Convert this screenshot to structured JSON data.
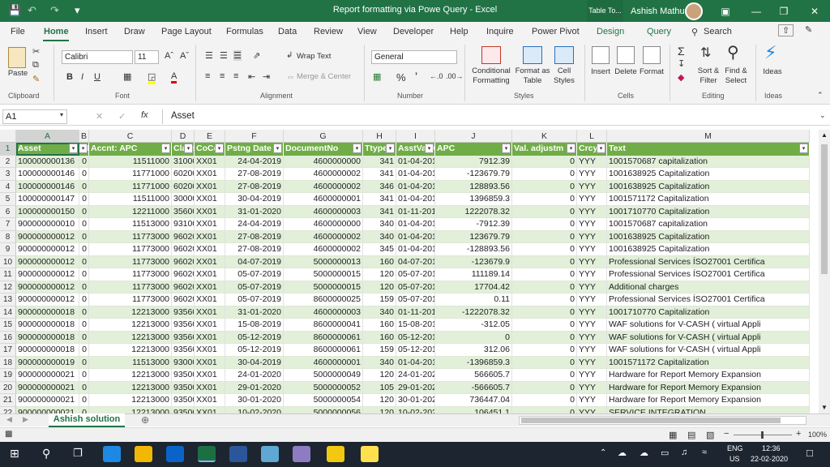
{
  "title_bar": {
    "title": "Report formatting via Powe Query  -  Excel",
    "table_tools": "Table To...",
    "user": "Ashish Mathur"
  },
  "menu": [
    "File",
    "Home",
    "Insert",
    "Draw",
    "Page Layout",
    "Formulas",
    "Data",
    "Review",
    "View",
    "Developer",
    "Help",
    "Inquire",
    "Power Pivot",
    "Design",
    "Query"
  ],
  "search_label": "Search",
  "ribbon": {
    "clipboard": {
      "paste": "Paste",
      "label": "Clipboard"
    },
    "font": {
      "name": "Calibri",
      "size": "11",
      "label": "Font"
    },
    "alignment": {
      "wrap": "Wrap Text",
      "merge": "Merge & Center",
      "label": "Alignment"
    },
    "number": {
      "format": "General",
      "label": "Number"
    },
    "styles": {
      "cond": "Conditional Formatting",
      "fmt_table": "Format as Table",
      "cell_styles": "Cell Styles",
      "label": "Styles"
    },
    "cells": {
      "insert": "Insert",
      "delete": "Delete",
      "format": "Format",
      "label": "Cells"
    },
    "editing": {
      "sort": "Sort & Filter",
      "find": "Find & Select",
      "label": "Editing"
    },
    "ideas": {
      "ideas": "Ideas",
      "label": "Ideas"
    }
  },
  "formula_bar": {
    "name_box": "A1",
    "content": "Asset"
  },
  "columns": [
    "A",
    "B",
    "C",
    "D",
    "E",
    "F",
    "G",
    "H",
    "I",
    "J",
    "K",
    "L",
    "M"
  ],
  "headers": [
    "Asset",
    "SNo.",
    "Accnt: APC",
    "Class",
    "CoCd",
    "Pstng Date",
    "DocumentNo",
    "Ttype",
    "AsstValDat",
    "APC",
    "Val. adjustm",
    "Crcy",
    "Text"
  ],
  "rows": [
    [
      "100000000136",
      "0",
      "11511000",
      "31000",
      "XX01",
      "24-04-2019",
      "4600000000",
      "341",
      "01-04-2019",
      "7912.39",
      "0",
      "YYY",
      "1001570687 capitalization"
    ],
    [
      "100000000146",
      "0",
      "11771000",
      "60200",
      "XX01",
      "27-08-2019",
      "4600000002",
      "341",
      "01-04-2019",
      "-123679.79",
      "0",
      "YYY",
      "1001638925 Capitalization"
    ],
    [
      "100000000146",
      "0",
      "11771000",
      "60200",
      "XX01",
      "27-08-2019",
      "4600000002",
      "346",
      "01-04-2019",
      "128893.56",
      "0",
      "YYY",
      "1001638925 Capitalization"
    ],
    [
      "100000000147",
      "0",
      "11511000",
      "30000",
      "XX01",
      "30-04-2019",
      "4600000001",
      "341",
      "01-04-2019",
      "1396859.3",
      "0",
      "YYY",
      "1001571172 Capitalization"
    ],
    [
      "100000000150",
      "0",
      "12211000",
      "35600",
      "XX01",
      "31-01-2020",
      "4600000003",
      "341",
      "01-11-2019",
      "1222078.32",
      "0",
      "YYY",
      "1001710770 Capitalization"
    ],
    [
      "900000000010",
      "0",
      "11513000",
      "93100",
      "XX01",
      "24-04-2019",
      "4600000000",
      "340",
      "01-04-2019",
      "-7912.39",
      "0",
      "YYY",
      "1001570687 capitalization"
    ],
    [
      "900000000012",
      "0",
      "11773000",
      "96020",
      "XX01",
      "27-08-2019",
      "4600000002",
      "340",
      "01-04-2019",
      "123679.79",
      "0",
      "YYY",
      "1001638925 Capitalization"
    ],
    [
      "900000000012",
      "0",
      "11773000",
      "96020",
      "XX01",
      "27-08-2019",
      "4600000002",
      "345",
      "01-04-2019",
      "-128893.56",
      "0",
      "YYY",
      "1001638925 Capitalization"
    ],
    [
      "900000000012",
      "0",
      "11773000",
      "96020",
      "XX01",
      "04-07-2019",
      "5000000013",
      "160",
      "04-07-2019",
      "-123679.9",
      "0",
      "YYY",
      "Professional Services ÍSO27001 Certifica"
    ],
    [
      "900000000012",
      "0",
      "11773000",
      "96020",
      "XX01",
      "05-07-2019",
      "5000000015",
      "120",
      "05-07-2019",
      "111189.14",
      "0",
      "YYY",
      "Professional Services ÍSO27001 Certifica"
    ],
    [
      "900000000012",
      "0",
      "11773000",
      "96020",
      "XX01",
      "05-07-2019",
      "5000000015",
      "120",
      "05-07-2019",
      "17704.42",
      "0",
      "YYY",
      "Additional charges"
    ],
    [
      "900000000012",
      "0",
      "11773000",
      "96020",
      "XX01",
      "05-07-2019",
      "8600000025",
      "159",
      "05-07-2019",
      "0.11",
      "0",
      "YYY",
      "Professional Services ÍSO27001 Certifica"
    ],
    [
      "900000000018",
      "0",
      "12213000",
      "93560",
      "XX01",
      "31-01-2020",
      "4600000003",
      "340",
      "01-11-2019",
      "-1222078.32",
      "0",
      "YYY",
      "1001710770 Capitalization"
    ],
    [
      "900000000018",
      "0",
      "12213000",
      "93560",
      "XX01",
      "15-08-2019",
      "8600000041",
      "160",
      "15-08-2019",
      "-312.05",
      "0",
      "YYY",
      "WAF solutions for V-CASH ( virtual Appli"
    ],
    [
      "900000000018",
      "0",
      "12213000",
      "93560",
      "XX01",
      "05-12-2019",
      "8600000061",
      "160",
      "05-12-2019",
      "0",
      "0",
      "YYY",
      "WAF solutions for V-CASH ( virtual Appli"
    ],
    [
      "900000000018",
      "0",
      "12213000",
      "93560",
      "XX01",
      "05-12-2019",
      "8600000061",
      "159",
      "05-12-2019",
      "312.06",
      "0",
      "YYY",
      "WAF solutions for V-CASH ( virtual Appli"
    ],
    [
      "900000000019",
      "0",
      "11513000",
      "93000",
      "XX01",
      "30-04-2019",
      "4600000001",
      "340",
      "01-04-2019",
      "-1396859.3",
      "0",
      "YYY",
      "1001571172 Capitalization"
    ],
    [
      "900000000021",
      "0",
      "12213000",
      "93500",
      "XX01",
      "24-01-2020",
      "5000000049",
      "120",
      "24-01-2020",
      "566605.7",
      "0",
      "YYY",
      " Hardware for Report Memory Expansion"
    ],
    [
      "900000000021",
      "0",
      "12213000",
      "93500",
      "XX01",
      "29-01-2020",
      "5000000052",
      "105",
      "29-01-2020",
      "-566605.7",
      "0",
      "YYY",
      " Hardware for Report Memory Expansion"
    ],
    [
      "900000000021",
      "0",
      "12213000",
      "93500",
      "XX01",
      "30-01-2020",
      "5000000054",
      "120",
      "30-01-2020",
      "736447.04",
      "0",
      "YYY",
      " Hardware for Report Memory Expansion"
    ],
    [
      "900000000021",
      "0",
      "12213000",
      "93500",
      "XX01",
      "10-02-2020",
      "5000000056",
      "120",
      "10-02-2020",
      "106451.1",
      "0",
      "YYY",
      "SERVICE INTEGRATION"
    ]
  ],
  "row_numbers": [
    "1",
    "2",
    "3",
    "4",
    "5",
    "6",
    "7",
    "8",
    "9",
    "10",
    "11",
    "12",
    "13",
    "14",
    "15",
    "16",
    "17",
    "18",
    "19",
    "20",
    "21",
    "22"
  ],
  "sheet_tab": "Ashish solution",
  "zoom": "100%",
  "taskbar": {
    "lang1": "ENG",
    "lang2": "US",
    "time": "12:36",
    "date": "22-02-2020"
  }
}
